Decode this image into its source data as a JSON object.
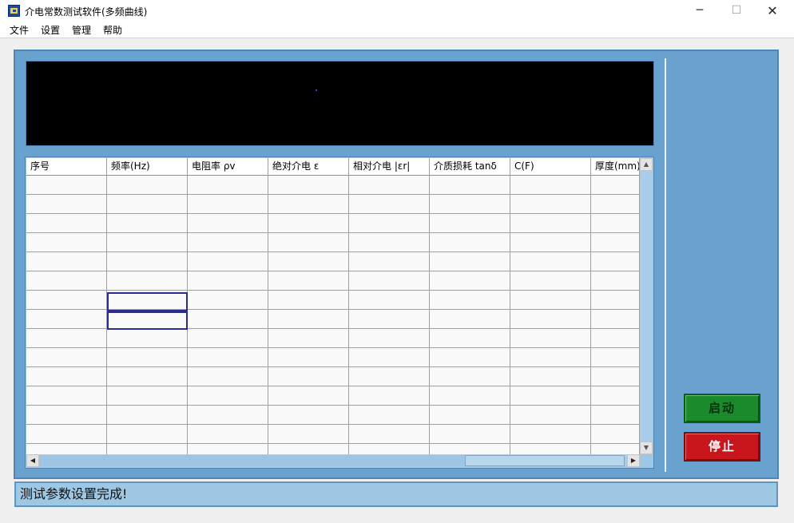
{
  "window": {
    "title": "介电常数测试软件(多频曲线)",
    "minimize_glyph": "─",
    "maximize_glyph": "☐",
    "close_glyph": "✕"
  },
  "menu": {
    "items": [
      "文件",
      "设置",
      "管理",
      "帮助"
    ]
  },
  "table": {
    "columns": [
      "序号",
      "频率(Hz)",
      "电阻率 ρv",
      "绝对介电 ε",
      "相对介电 |εr|",
      "介质损耗 tanδ",
      "C(F)",
      "厚度(mm)"
    ],
    "row_count": 15
  },
  "scrollbars": {
    "up_glyph": "▲",
    "down_glyph": "▼",
    "left_glyph": "◀",
    "right_glyph": "▶"
  },
  "buttons": {
    "start_label": "启动",
    "stop_label": "停止"
  },
  "status": {
    "message": "测试参数设置完成!"
  },
  "colors": {
    "panel": "#6aa2cf",
    "start_button": "#1a8a2a",
    "stop_button": "#c8161d",
    "status_bar": "#9ec7e3",
    "display": "#000000"
  }
}
